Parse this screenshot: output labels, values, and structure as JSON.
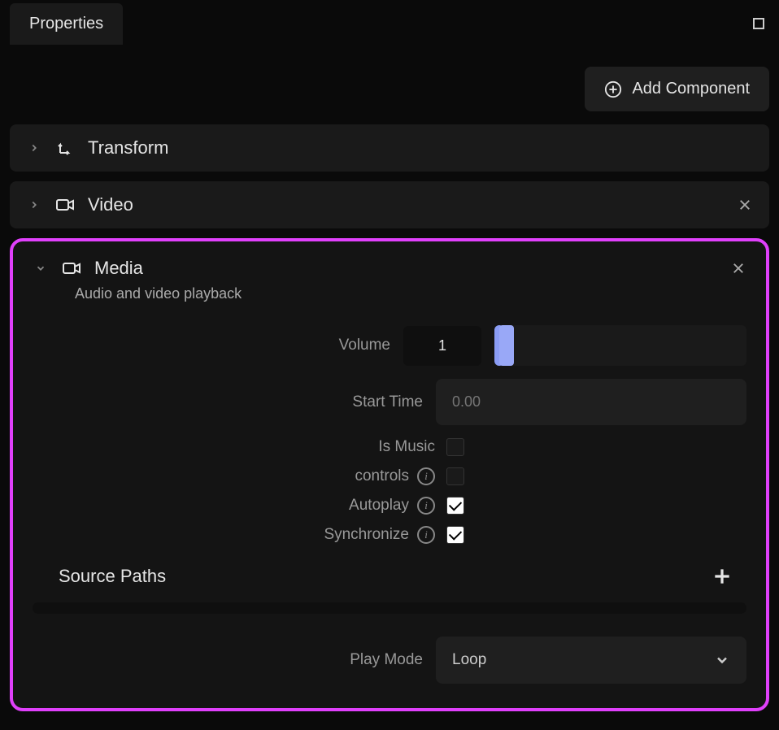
{
  "tab": {
    "label": "Properties"
  },
  "addComponent": {
    "label": "Add Component"
  },
  "components": {
    "transform": {
      "title": "Transform"
    },
    "video": {
      "title": "Video"
    },
    "media": {
      "title": "Media",
      "subtitle": "Audio and video playback",
      "volume": {
        "label": "Volume",
        "value": "1"
      },
      "startTime": {
        "label": "Start Time",
        "placeholder": "0.00"
      },
      "isMusic": {
        "label": "Is Music",
        "checked": false
      },
      "controls": {
        "label": "controls",
        "checked": false
      },
      "autoplay": {
        "label": "Autoplay",
        "checked": true
      },
      "synchronize": {
        "label": "Synchronize",
        "checked": true
      },
      "sourcePaths": {
        "title": "Source Paths"
      },
      "playMode": {
        "label": "Play Mode",
        "value": "Loop"
      }
    }
  }
}
